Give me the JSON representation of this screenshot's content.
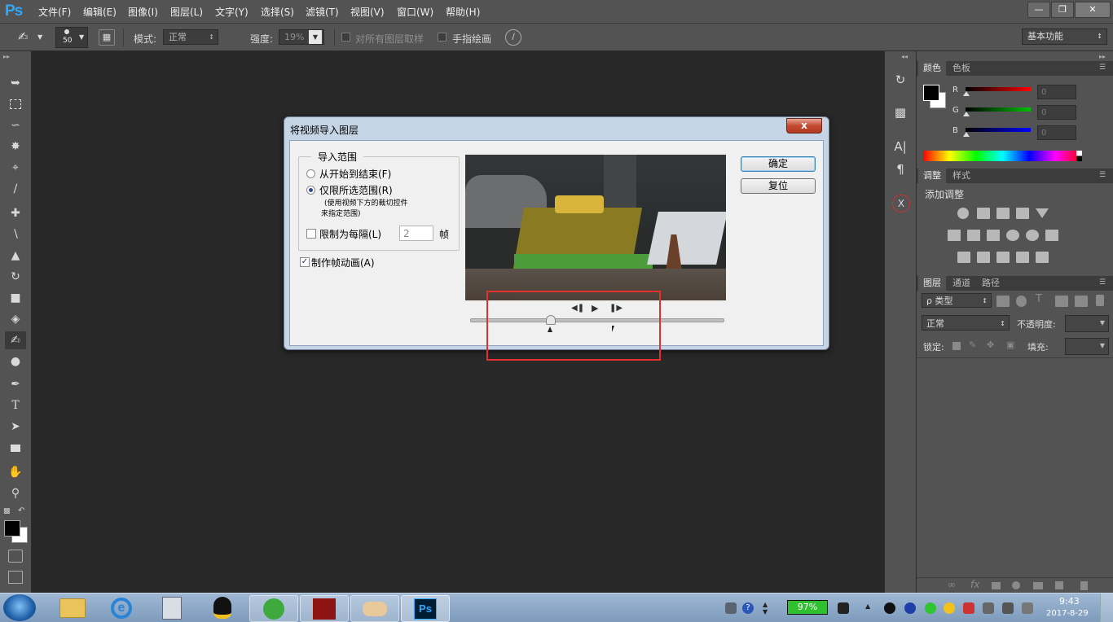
{
  "app": {
    "logo": "Ps",
    "menu": [
      "文件(F)",
      "编辑(E)",
      "图像(I)",
      "图层(L)",
      "文字(Y)",
      "选择(S)",
      "滤镜(T)",
      "视图(V)",
      "窗口(W)",
      "帮助(H)"
    ],
    "window_controls": [
      "minimize",
      "restore",
      "close"
    ]
  },
  "options_bar": {
    "brush_size": "50",
    "mode_label": "模式:",
    "mode_value": "正常",
    "strength_label": "强度:",
    "strength_value": "19%",
    "sample_all_label": "对所有图层取样",
    "finger_paint_label": "手指绘画",
    "workspace_value": "基本功能"
  },
  "toolbar": {
    "tools": [
      "move-tool",
      "marquee-tool",
      "lasso-tool",
      "magic-wand-tool",
      "crop-tool",
      "eyedropper-tool",
      "healing-brush-tool",
      "brush-tool",
      "clone-stamp-tool",
      "history-brush-tool",
      "eraser-tool",
      "paint-bucket-tool",
      "smudge-tool",
      "dodge-tool",
      "pen-tool",
      "type-tool",
      "path-selection-tool",
      "rectangle-tool",
      "hand-tool",
      "zoom-tool"
    ],
    "type_tool_glyph": "T"
  },
  "color_panel": {
    "tabs": [
      "颜色",
      "色板"
    ],
    "channels": [
      {
        "label": "R",
        "value": "0",
        "color": "#ff0000"
      },
      {
        "label": "G",
        "value": "0",
        "color": "#00c000"
      },
      {
        "label": "B",
        "value": "0",
        "color": "#0000ff"
      }
    ]
  },
  "adjustments_panel": {
    "tabs": [
      "调整",
      "样式"
    ],
    "title": "添加调整"
  },
  "layers_panel": {
    "tabs": [
      "图层",
      "通道",
      "路径"
    ],
    "filter_value": "ρ 类型",
    "blend_value": "正常",
    "opacity_label": "不透明度:",
    "lock_label": "锁定:",
    "fill_label": "填充:"
  },
  "dock": {
    "icons": [
      "history-icon",
      "3d-icon",
      "character-icon",
      "paragraph-icon",
      "x-icon"
    ],
    "character_glyph": "A|",
    "paragraph_glyph": "¶",
    "x_glyph": "X"
  },
  "dialog": {
    "title": "将视频导入图层",
    "close_label": "x",
    "group_title": "导入范围",
    "radio_from_start": "从开始到结束(F)",
    "radio_selected_range": "仅限所选范围(R)",
    "hint_line1": "(使用视频下方的裁切控件",
    "hint_line2": "来指定范围)",
    "limit_label": "限制为每隔(L)",
    "limit_value": "2",
    "limit_unit": "帧",
    "animation_label": "制作帧动画(A)",
    "ok_label": "确定",
    "reset_label": "复位"
  },
  "taskbar": {
    "apps": [
      "windows-start-icon",
      "explorer-icon",
      "ie-icon",
      "calculator-icon",
      "qq-icon",
      "360-icon",
      "acrobat-icon",
      "handshake-icon",
      "photoshop-icon"
    ],
    "battery": "97%",
    "time": "9:43",
    "date": "2017-8-29"
  }
}
